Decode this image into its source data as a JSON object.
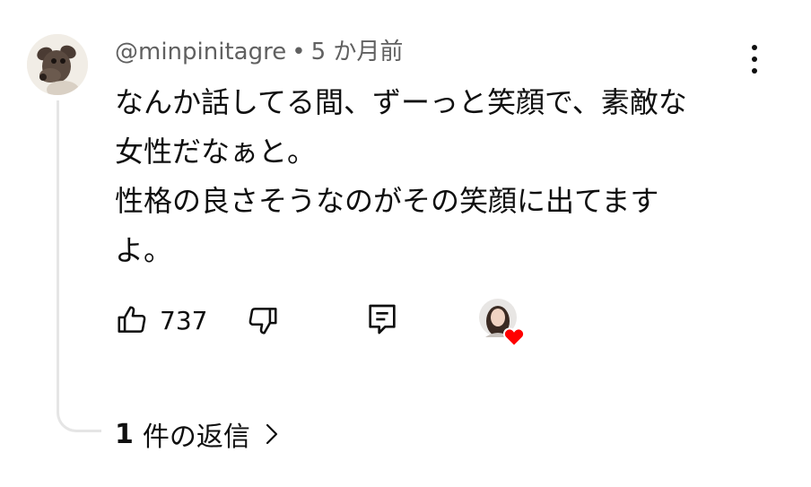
{
  "comment": {
    "username": "@minpinitagre",
    "separator": "•",
    "timestamp": "5 か月前",
    "text_lines": [
      "なんか話してる間、ずーっと笑顔で、素敵な",
      "女性だなぁと。",
      "性格の良さそうなのがその笑顔に出てます",
      "よ。"
    ],
    "likes": "737"
  },
  "replies": {
    "count": "1",
    "label": "件の返信"
  },
  "icons": {
    "avatar": "dog-avatar",
    "more": "more-vertical-icon",
    "like": "thumb-up-icon",
    "dislike": "thumb-down-icon",
    "reply": "comment-reply-icon",
    "hearted": "creator-heart-avatar",
    "chevron": "chevron-right-icon"
  },
  "colors": {
    "text": "#0f0f0f",
    "meta": "#606060",
    "heart": "#ff0000",
    "thread_line": "#e5e5e5"
  }
}
